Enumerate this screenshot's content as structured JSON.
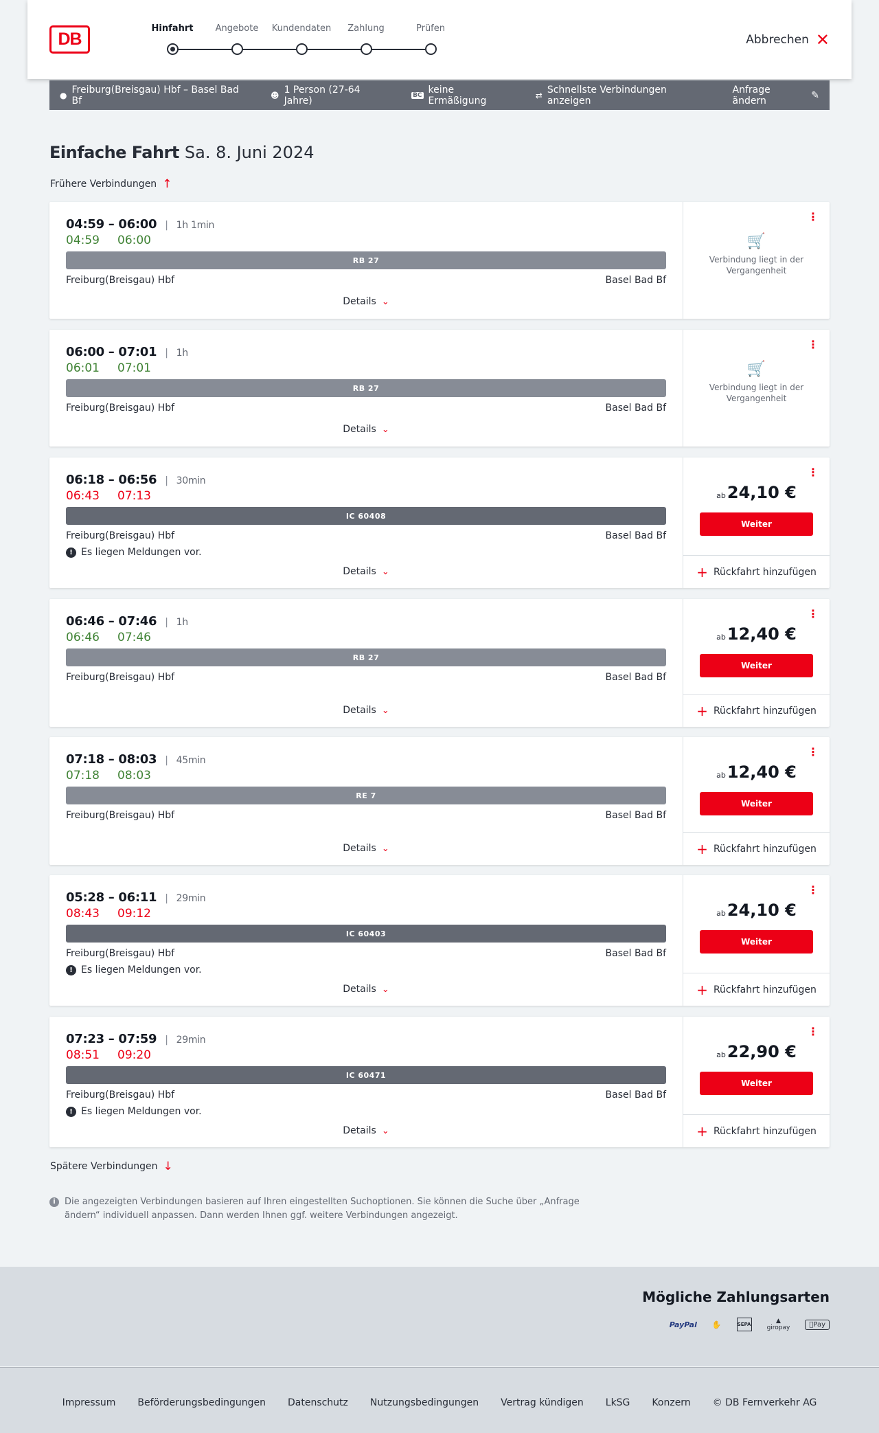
{
  "header": {
    "logo_text": "DB",
    "steps": [
      {
        "label": "Hinfahrt",
        "active": true
      },
      {
        "label": "Angebote",
        "active": false
      },
      {
        "label": "Kundendaten",
        "active": false
      },
      {
        "label": "Zahlung",
        "active": false
      },
      {
        "label": "Prüfen",
        "active": false
      }
    ],
    "cancel_label": "Abbrechen"
  },
  "search_bar": {
    "route": "Freiburg(Breisgau) Hbf – Basel Bad Bf",
    "passengers": "1 Person (27-64 Jahre)",
    "discount_badge": "BC",
    "discount": "keine Ermäßigung",
    "option": "Schnellste Verbindungen anzeigen",
    "edit_label": "Anfrage ändern"
  },
  "page_title": {
    "type": "Einfache Fahrt",
    "date": "Sa. 8. Juni 2024"
  },
  "earlier_label": "Frühere Verbindungen",
  "later_label": "Spätere Verbindungen",
  "connections": [
    {
      "planned": "04:59 – 06:00",
      "duration": "1h 1min",
      "rt_dep": "04:59",
      "rt_arr": "06:00",
      "rt_status": "ok",
      "train": "RB 27",
      "train_kind": "rb",
      "from": "Freiburg(Breisgau) Hbf",
      "to": "Basel Bad Bf",
      "message": null,
      "details": "Details",
      "past": true,
      "past_text": "Verbindung liegt in der Vergangenheit"
    },
    {
      "planned": "06:00 – 07:01",
      "duration": "1h",
      "rt_dep": "06:01",
      "rt_arr": "07:01",
      "rt_status": "ok",
      "train": "RB 27",
      "train_kind": "rb",
      "from": "Freiburg(Breisgau) Hbf",
      "to": "Basel Bad Bf",
      "message": null,
      "details": "Details",
      "past": true,
      "past_text": "Verbindung liegt in der Vergangenheit"
    },
    {
      "planned": "06:18 – 06:56",
      "duration": "30min",
      "rt_dep": "06:43",
      "rt_arr": "07:13",
      "rt_status": "late",
      "train": "IC 60408",
      "train_kind": "ic",
      "from": "Freiburg(Breisgau) Hbf",
      "to": "Basel Bad Bf",
      "message": "Es liegen Meldungen vor.",
      "details": "Details",
      "past": false,
      "price_prefix": "ab",
      "price": "24,10 €",
      "button": "Weiter",
      "return_label": "Rückfahrt hinzufügen"
    },
    {
      "planned": "06:46 – 07:46",
      "duration": "1h",
      "rt_dep": "06:46",
      "rt_arr": "07:46",
      "rt_status": "ok",
      "train": "RB 27",
      "train_kind": "rb",
      "from": "Freiburg(Breisgau) Hbf",
      "to": "Basel Bad Bf",
      "message": null,
      "details": "Details",
      "past": false,
      "price_prefix": "ab",
      "price": "12,40 €",
      "button": "Weiter",
      "return_label": "Rückfahrt hinzufügen"
    },
    {
      "planned": "07:18 – 08:03",
      "duration": "45min",
      "rt_dep": "07:18",
      "rt_arr": "08:03",
      "rt_status": "ok",
      "train": "RE 7",
      "train_kind": "rb",
      "from": "Freiburg(Breisgau) Hbf",
      "to": "Basel Bad Bf",
      "message": null,
      "details": "Details",
      "past": false,
      "price_prefix": "ab",
      "price": "12,40 €",
      "button": "Weiter",
      "return_label": "Rückfahrt hinzufügen"
    },
    {
      "planned": "05:28 – 06:11",
      "duration": "29min",
      "rt_dep": "08:43",
      "rt_arr": "09:12",
      "rt_status": "late",
      "train": "IC 60403",
      "train_kind": "ic",
      "from": "Freiburg(Breisgau) Hbf",
      "to": "Basel Bad Bf",
      "message": "Es liegen Meldungen vor.",
      "details": "Details",
      "past": false,
      "price_prefix": "ab",
      "price": "24,10 €",
      "button": "Weiter",
      "return_label": "Rückfahrt hinzufügen"
    },
    {
      "planned": "07:23 – 07:59",
      "duration": "29min",
      "rt_dep": "08:51",
      "rt_arr": "09:20",
      "rt_status": "late",
      "train": "IC 60471",
      "train_kind": "ic",
      "from": "Freiburg(Breisgau) Hbf",
      "to": "Basel Bad Bf",
      "message": "Es liegen Meldungen vor.",
      "details": "Details",
      "past": false,
      "price_prefix": "ab",
      "price": "22,90 €",
      "button": "Weiter",
      "return_label": "Rückfahrt hinzufügen"
    }
  ],
  "info_text": "Die angezeigten Verbindungen basieren auf Ihren eingestellten Suchoptionen. Sie können die Suche über „Anfrage ändern“ individuell anpassen. Dann werden Ihnen ggf. weitere Verbindungen angezeigt.",
  "payment": {
    "title": "Mögliche Zahlungsarten",
    "methods": [
      "PayPal",
      "Kreditkarte",
      "SEPA",
      "giropay",
      "Apple Pay"
    ],
    "sepa_text": "SEPA",
    "giropay_text": "giropay",
    "applepay_text": "Pay"
  },
  "footer_links": [
    "Impressum",
    "Beförderungsbedingungen",
    "Datenschutz",
    "Nutzungsbedingungen",
    "Vertrag kündigen",
    "LkSG",
    "Konzern",
    "© DB Fernverkehr AG"
  ],
  "colors": {
    "accent": "#ec0016",
    "on_time": "#408335",
    "late": "#ec0016",
    "bar": "#646973"
  }
}
